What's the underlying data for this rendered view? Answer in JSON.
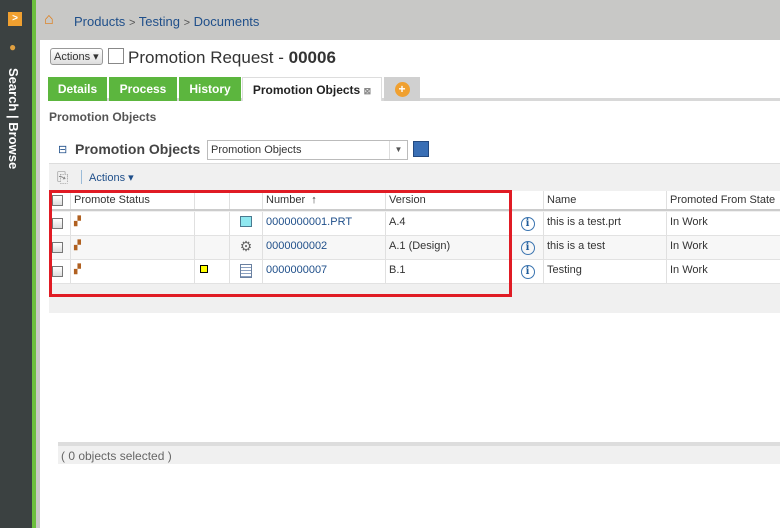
{
  "sidebar": {
    "vertical_label": "Search | Browse"
  },
  "breadcrumb": [
    "Products",
    "Testing",
    "Documents"
  ],
  "header": {
    "actions_label": "Actions",
    "title_prefix": "Promotion Request - ",
    "title_number": "00006"
  },
  "tabs": [
    {
      "label": "Details"
    },
    {
      "label": "Process"
    },
    {
      "label": "History"
    },
    {
      "label": "Promotion Objects",
      "active": true
    }
  ],
  "section_label": "Promotion Objects",
  "panel": {
    "title": "Promotion Objects",
    "view_select": "Promotion Objects",
    "actions_label": "Actions"
  },
  "table": {
    "columns": [
      "Promote Status",
      "",
      "",
      "Number",
      "Version",
      "",
      "Name",
      "Promoted From State"
    ],
    "sort_indicator": "↑",
    "rows": [
      {
        "number": "0000000001.PRT",
        "version": "A.4",
        "name": "this is a test.prt",
        "state": "In Work",
        "type_icon": "part-icon"
      },
      {
        "number": "0000000002",
        "version": "A.1 (Design)",
        "name": "this is a test",
        "state": "In Work",
        "type_icon": "gear-icon"
      },
      {
        "number": "0000000007",
        "version": "B.1",
        "name": "Testing",
        "state": "In Work",
        "type_icon": "document-icon"
      }
    ],
    "footer": "( 0 objects selected )"
  }
}
